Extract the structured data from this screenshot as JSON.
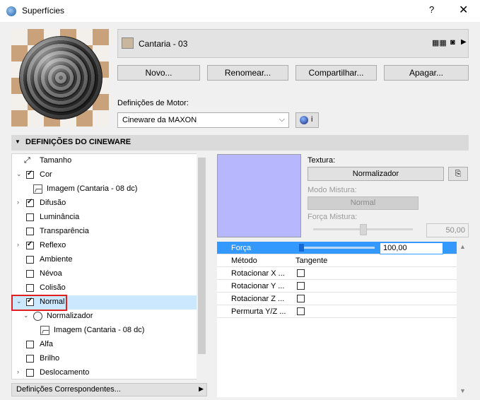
{
  "window": {
    "title": "Superfícies",
    "help": "?",
    "close": "✕"
  },
  "material": {
    "name": "Cantaria - 03",
    "swatch_color": "#c8b69d"
  },
  "buttons": {
    "new": "Novo...",
    "rename": "Renomear...",
    "share": "Compartilhar...",
    "delete": "Apagar..."
  },
  "engine": {
    "label": "Definições de Motor:",
    "value": "Cineware da MAXON",
    "info": "i"
  },
  "section": {
    "title": "DEFINIÇÕES DO CINEWARE"
  },
  "tree": [
    {
      "label": "Tamanho"
    },
    {
      "label": "Cor"
    },
    {
      "label": "Imagem (Cantaria - 08 dc)"
    },
    {
      "label": "Difusão"
    },
    {
      "label": "Luminância"
    },
    {
      "label": "Transparência"
    },
    {
      "label": "Reflexo"
    },
    {
      "label": "Ambiente"
    },
    {
      "label": "Névoa"
    },
    {
      "label": "Colisão"
    },
    {
      "label": "Normal"
    },
    {
      "label": "Normalizador"
    },
    {
      "label": "Imagem (Cantaria - 08 dc)"
    },
    {
      "label": "Alfa"
    },
    {
      "label": "Brilho"
    },
    {
      "label": "Deslocamento"
    }
  ],
  "footer": {
    "matching_label": "Definições Correspondentes..."
  },
  "texture": {
    "label": "Textura:",
    "value": "Normalizador",
    "blend_mode_label": "Modo Mistura:",
    "blend_mode_value": "Normal",
    "blend_strength_label": "Força Mistura:",
    "blend_strength_value": "50,00"
  },
  "props": {
    "strength_label": "Força",
    "strength_value": "100,00",
    "method_label": "Método",
    "method_value": "Tangente",
    "rot_x": "Rotacionar X ...",
    "rot_y": "Rotacionar Y ...",
    "rot_z": "Rotacionar Z ...",
    "swap_yz": "Permurta Y/Z ..."
  }
}
